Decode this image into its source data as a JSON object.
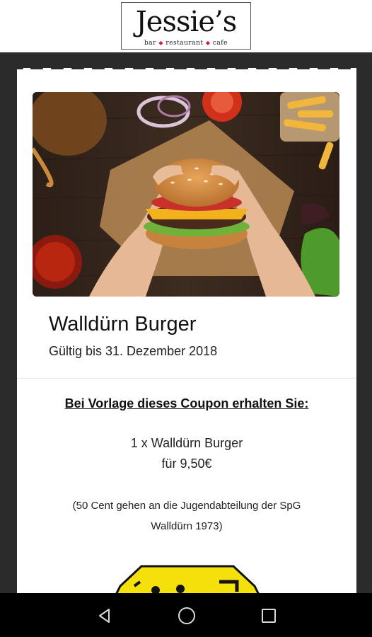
{
  "header": {
    "logo_name": "Jessie’s",
    "logo_tagline": [
      "bar",
      "restaurant",
      "cafe"
    ]
  },
  "coupon": {
    "image_alt": "burger-photo",
    "title": "Walldürn Burger",
    "validity": "Gültig bis 31. Dezember 2018",
    "offer_heading": "Bei Vorlage dieses Coupon erhalten Sie:",
    "offer_item": "1 x Walldürn Burger",
    "offer_price": "für 9,50€",
    "note": "(50 Cent gehen an die Jugendabteilung der SpG Walldürn 1973)"
  },
  "navbar": {
    "back": "back-icon",
    "home": "home-icon",
    "recents": "recents-icon"
  },
  "colors": {
    "background": "#2b2b2b",
    "card": "#ffffff",
    "accent_red": "#d0202a",
    "teaser_yellow": "#f4e00b"
  }
}
